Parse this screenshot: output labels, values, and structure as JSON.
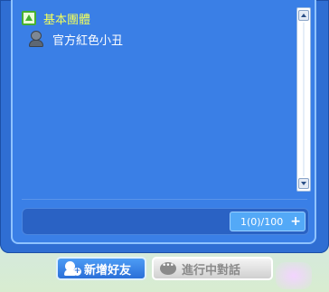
{
  "friend_list": {
    "group": {
      "name": "基本團體",
      "expanded": true
    },
    "friends": [
      {
        "name": "官方紅色小丑",
        "status": "offline"
      }
    ]
  },
  "footer": {
    "count": "1(0)/100"
  },
  "buttons": {
    "add_friend": "新增好友",
    "active_chat": "進行中對話"
  },
  "colors": {
    "panel": "#3a7fe6",
    "group_text": "#f3ff5a",
    "friend_text": "#ffffff",
    "accent": "#2a6fd8"
  }
}
